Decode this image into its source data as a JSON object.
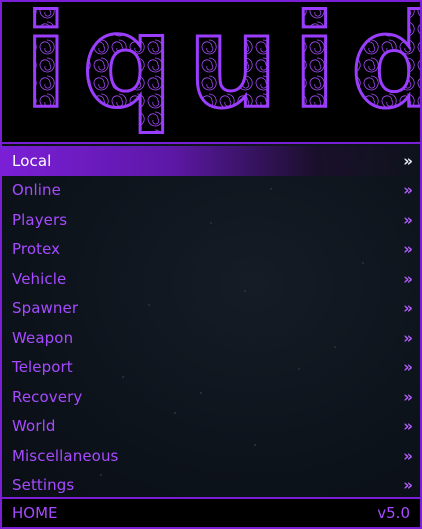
{
  "banner": {
    "logo_text": "liquid"
  },
  "menu": {
    "items": [
      {
        "label": "Local",
        "active": true
      },
      {
        "label": "Online"
      },
      {
        "label": "Players"
      },
      {
        "label": "Protex"
      },
      {
        "label": "Vehicle"
      },
      {
        "label": "Spawner"
      },
      {
        "label": "Weapon"
      },
      {
        "label": "Teleport"
      },
      {
        "label": "Recovery"
      },
      {
        "label": "World"
      },
      {
        "label": "Miscellaneous"
      },
      {
        "label": "Settings"
      }
    ],
    "chevron_glyph": "»"
  },
  "footer": {
    "left_label": "HOME",
    "version": "v5.0"
  },
  "colors": {
    "accent": "#7a1fd6",
    "text": "#a64bff",
    "active_text": "#ffffff",
    "background": "#0d131b"
  }
}
